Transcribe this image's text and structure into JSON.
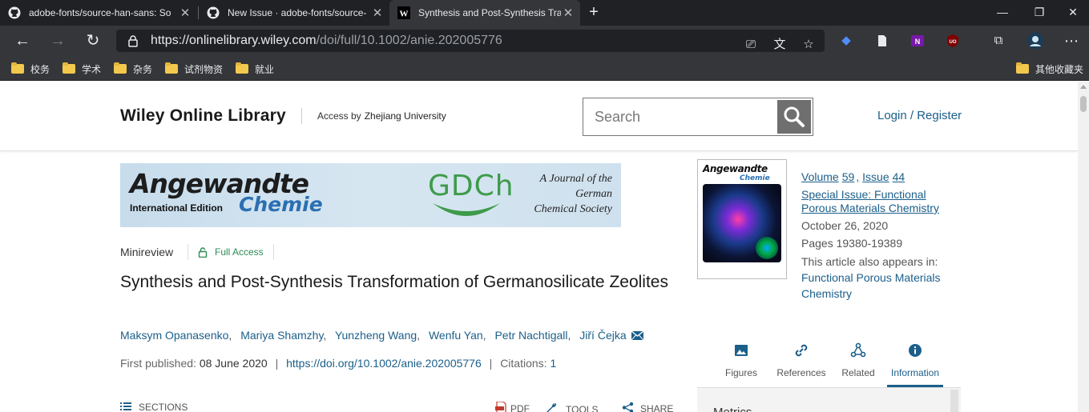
{
  "tabs": [
    {
      "title": "adobe-fonts/source-han-sans: So",
      "icon": "github-icon",
      "active": false
    },
    {
      "title": "New Issue · adobe-fonts/source-",
      "icon": "github-icon",
      "active": false
    },
    {
      "title": "Synthesis and Post-Synthesis Tran",
      "icon": "wiley-w-icon",
      "active": true
    }
  ],
  "address": {
    "scheme": "https://",
    "host": "onlinelibrary.wiley.com",
    "path": "/doi/full/10.1002/anie.202005776"
  },
  "bookmarks": [
    "校务",
    "学术",
    "杂务",
    "试剂物资",
    "就业"
  ],
  "other_bookmarks": "其他收藏夹",
  "site": {
    "logo": "Wiley Online Library",
    "access_prefix": "Access by",
    "access_org": "Zhejiang University",
    "search_placeholder": "Search",
    "login": "Login / Register"
  },
  "banner": {
    "journal_name": "Angewandte",
    "edition": "International Edition",
    "journal_name2": "Chemie",
    "society_logo": "GDCh",
    "tagline_1": "A Journal of the",
    "tagline_2": "German",
    "tagline_3": "Chemical Society"
  },
  "article": {
    "type": "Minireview",
    "access": "Full Access",
    "title": "Synthesis and Post-Synthesis Transformation of Germanosilicate Zeolites",
    "authors": [
      "Maksym Opanasenko",
      "Mariya Shamzhy",
      "Yunzheng Wang",
      "Wenfu Yan",
      "Petr Nachtigall",
      "Jiří Čejka"
    ],
    "first_published_label": "First published:",
    "first_published": "08 June 2020",
    "doi": "https://doi.org/10.1002/anie.202005776",
    "citations_label": "Citations:",
    "citations": "1"
  },
  "toolbar": {
    "sections": "SECTIONS",
    "pdf": "PDF",
    "tools": "TOOLS",
    "share": "SHARE"
  },
  "issue": {
    "volume_label": "Volume",
    "volume": "59",
    "issue_label": "Issue",
    "issue": "44",
    "special_line1": "Special Issue: Functional",
    "special_line2": "Porous Materials Chemistry",
    "date": "October 26, 2020",
    "pages": "Pages 19380-19389",
    "also_appears": "This article also appears in:",
    "collection_line1": "Functional Porous Materials",
    "collection_line2": "Chemistry"
  },
  "cover": {
    "title": "Angewandte",
    "subtitle": "Chemie"
  },
  "info_tabs": [
    {
      "label": "Figures",
      "icon": "image-icon"
    },
    {
      "label": "References",
      "icon": "link-icon"
    },
    {
      "label": "Related",
      "icon": "network-icon"
    },
    {
      "label": "Information",
      "icon": "info-icon",
      "active": true
    }
  ],
  "metrics_heading": "Metrics",
  "colors": {
    "link": "#1b5f8a",
    "access_green": "#2e8b57",
    "chrome_dark": "#202124",
    "chrome": "#35363a"
  }
}
